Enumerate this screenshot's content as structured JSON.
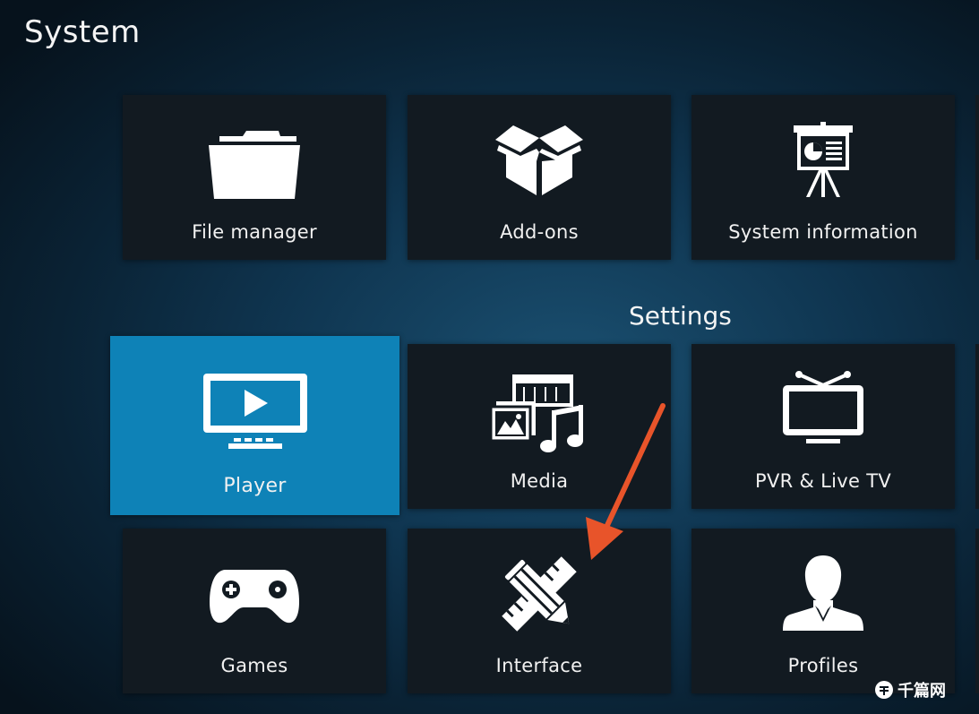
{
  "window": {
    "title": "System"
  },
  "system_row": [
    {
      "label": "File manager",
      "icon": "folder-icon"
    },
    {
      "label": "Add-ons",
      "icon": "open-box-icon"
    },
    {
      "label": "System information",
      "icon": "presentation-board-icon"
    }
  ],
  "settings": {
    "title": "Settings",
    "items": [
      {
        "label": "Player",
        "icon": "tv-play-icon",
        "focused": true
      },
      {
        "label": "Media",
        "icon": "media-icon"
      },
      {
        "label": "PVR & Live TV",
        "icon": "antenna-tv-icon"
      },
      {
        "label": "Games",
        "icon": "gamepad-icon"
      },
      {
        "label": "Interface",
        "icon": "pencil-ruler-icon"
      },
      {
        "label": "Profiles",
        "icon": "person-icon"
      }
    ]
  },
  "colors": {
    "focus": "#0e82b7",
    "tile": "#121a21",
    "annotation_arrow": "#e8542a"
  },
  "watermark": {
    "text": "千篇网",
    "icon": "watermark-logo-icon"
  }
}
